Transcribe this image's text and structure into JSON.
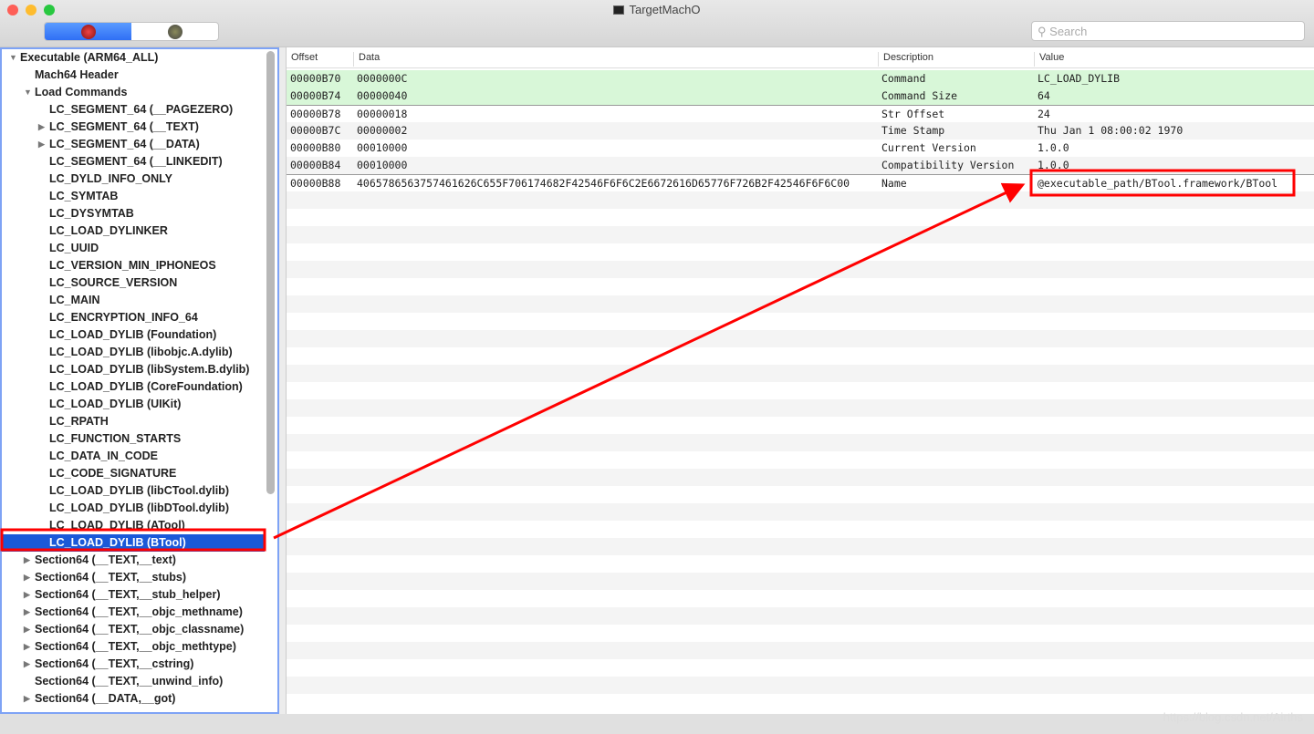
{
  "window": {
    "title": "TargetMachO",
    "search_placeholder": "Search"
  },
  "tree": [
    {
      "label": "Executable  (ARM64_ALL)",
      "level": 0,
      "arrow": "down"
    },
    {
      "label": "Mach64 Header",
      "level": 1,
      "arrow": ""
    },
    {
      "label": "Load Commands",
      "level": 1,
      "arrow": "down"
    },
    {
      "label": "LC_SEGMENT_64 (__PAGEZERO)",
      "level": 2,
      "arrow": ""
    },
    {
      "label": "LC_SEGMENT_64 (__TEXT)",
      "level": 2,
      "arrow": "right"
    },
    {
      "label": "LC_SEGMENT_64 (__DATA)",
      "level": 2,
      "arrow": "right"
    },
    {
      "label": "LC_SEGMENT_64 (__LINKEDIT)",
      "level": 2,
      "arrow": ""
    },
    {
      "label": "LC_DYLD_INFO_ONLY",
      "level": 2,
      "arrow": ""
    },
    {
      "label": "LC_SYMTAB",
      "level": 2,
      "arrow": ""
    },
    {
      "label": "LC_DYSYMTAB",
      "level": 2,
      "arrow": ""
    },
    {
      "label": "LC_LOAD_DYLINKER",
      "level": 2,
      "arrow": ""
    },
    {
      "label": "LC_UUID",
      "level": 2,
      "arrow": ""
    },
    {
      "label": "LC_VERSION_MIN_IPHONEOS",
      "level": 2,
      "arrow": ""
    },
    {
      "label": "LC_SOURCE_VERSION",
      "level": 2,
      "arrow": ""
    },
    {
      "label": "LC_MAIN",
      "level": 2,
      "arrow": ""
    },
    {
      "label": "LC_ENCRYPTION_INFO_64",
      "level": 2,
      "arrow": ""
    },
    {
      "label": "LC_LOAD_DYLIB (Foundation)",
      "level": 2,
      "arrow": ""
    },
    {
      "label": "LC_LOAD_DYLIB (libobjc.A.dylib)",
      "level": 2,
      "arrow": ""
    },
    {
      "label": "LC_LOAD_DYLIB (libSystem.B.dylib)",
      "level": 2,
      "arrow": ""
    },
    {
      "label": "LC_LOAD_DYLIB (CoreFoundation)",
      "level": 2,
      "arrow": ""
    },
    {
      "label": "LC_LOAD_DYLIB (UIKit)",
      "level": 2,
      "arrow": ""
    },
    {
      "label": "LC_RPATH",
      "level": 2,
      "arrow": ""
    },
    {
      "label": "LC_FUNCTION_STARTS",
      "level": 2,
      "arrow": ""
    },
    {
      "label": "LC_DATA_IN_CODE",
      "level": 2,
      "arrow": ""
    },
    {
      "label": "LC_CODE_SIGNATURE",
      "level": 2,
      "arrow": ""
    },
    {
      "label": "LC_LOAD_DYLIB (libCTool.dylib)",
      "level": 2,
      "arrow": ""
    },
    {
      "label": "LC_LOAD_DYLIB (libDTool.dylib)",
      "level": 2,
      "arrow": ""
    },
    {
      "label": "LC_LOAD_DYLIB (ATool)",
      "level": 2,
      "arrow": ""
    },
    {
      "label": "LC_LOAD_DYLIB (BTool)",
      "level": 2,
      "arrow": "",
      "selected": true
    },
    {
      "label": "Section64 (__TEXT,__text)",
      "level": 1,
      "arrow": "right"
    },
    {
      "label": "Section64 (__TEXT,__stubs)",
      "level": 1,
      "arrow": "right"
    },
    {
      "label": "Section64 (__TEXT,__stub_helper)",
      "level": 1,
      "arrow": "right"
    },
    {
      "label": "Section64 (__TEXT,__objc_methname)",
      "level": 1,
      "arrow": "right"
    },
    {
      "label": "Section64 (__TEXT,__objc_classname)",
      "level": 1,
      "arrow": "right"
    },
    {
      "label": "Section64 (__TEXT,__objc_methtype)",
      "level": 1,
      "arrow": "right"
    },
    {
      "label": "Section64 (__TEXT,__cstring)",
      "level": 1,
      "arrow": "right"
    },
    {
      "label": "Section64 (__TEXT,__unwind_info)",
      "level": 1,
      "arrow": ""
    },
    {
      "label": "Section64 (__DATA,__got)",
      "level": 1,
      "arrow": "right"
    }
  ],
  "table": {
    "columns": [
      "Offset",
      "Data",
      "Description",
      "Value"
    ],
    "rows": [
      {
        "offset": "00000B70",
        "data": "0000000C",
        "description": "Command",
        "value": "LC_LOAD_DYLIB",
        "highlight": true
      },
      {
        "offset": "00000B74",
        "data": "00000040",
        "description": "Command Size",
        "value": "64",
        "highlight": true
      },
      {
        "offset": "00000B78",
        "data": "00000018",
        "description": "Str Offset",
        "value": "24"
      },
      {
        "offset": "00000B7C",
        "data": "00000002",
        "description": "Time Stamp",
        "value": "Thu Jan  1 08:00:02 1970"
      },
      {
        "offset": "00000B80",
        "data": "00010000",
        "description": "Current Version",
        "value": "1.0.0"
      },
      {
        "offset": "00000B84",
        "data": "00010000",
        "description": "Compatibility Version",
        "value": "1.0.0"
      },
      {
        "offset": "00000B88",
        "data": "4065786563757461626C655F706174682F42546F6F6C2E6672616D65776F726B2F42546F6F6C00",
        "description": "Name",
        "value": "@executable_path/BTool.framework/BTool"
      }
    ]
  },
  "annotation_color": "#ff0000",
  "watermark": "https://blog.csdn.net/Airths"
}
